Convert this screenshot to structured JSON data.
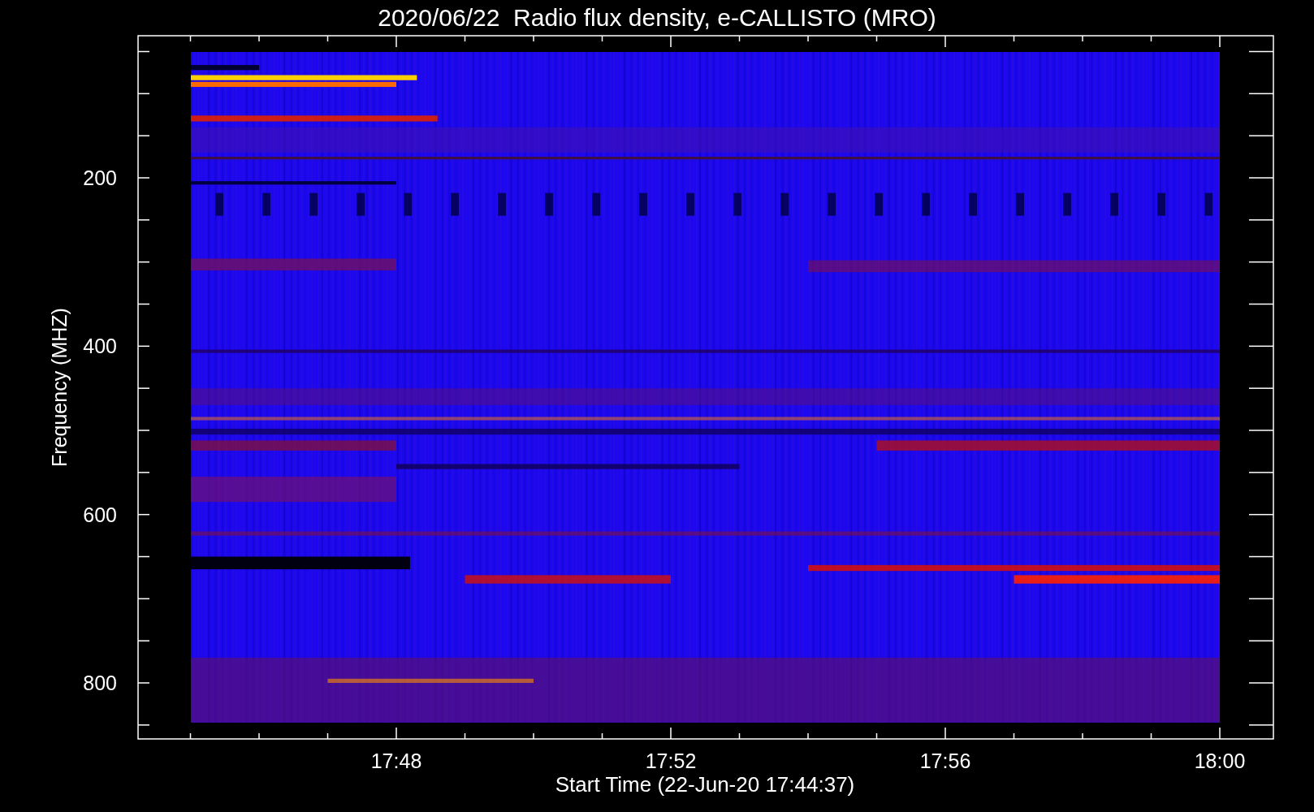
{
  "title": "2020/06/22  Radio flux density, e-CALLISTO (MRO)",
  "plot": {
    "ylabel": "Frequency (MHZ)",
    "xlabel": "Start Time (22-Jun-20 17:44:37)",
    "yticks": [
      "200",
      "400",
      "600",
      "800"
    ],
    "xticks": [
      "17:48",
      "17:52",
      "17:56",
      "18:00"
    ]
  }
}
